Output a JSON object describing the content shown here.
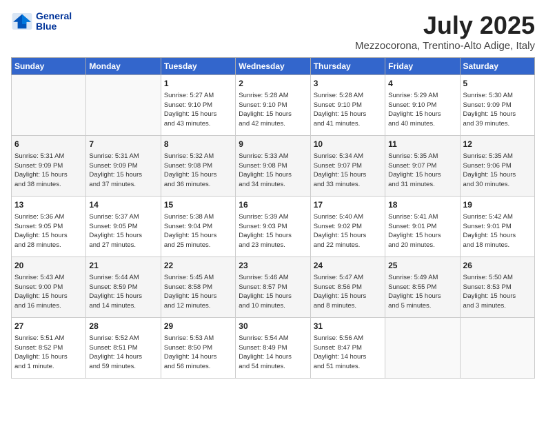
{
  "header": {
    "logo_line1": "General",
    "logo_line2": "Blue",
    "month_year": "July 2025",
    "location": "Mezzocorona, Trentino-Alto Adige, Italy"
  },
  "weekdays": [
    "Sunday",
    "Monday",
    "Tuesday",
    "Wednesday",
    "Thursday",
    "Friday",
    "Saturday"
  ],
  "weeks": [
    [
      {
        "day": "",
        "info": ""
      },
      {
        "day": "",
        "info": ""
      },
      {
        "day": "1",
        "info": "Sunrise: 5:27 AM\nSunset: 9:10 PM\nDaylight: 15 hours\nand 43 minutes."
      },
      {
        "day": "2",
        "info": "Sunrise: 5:28 AM\nSunset: 9:10 PM\nDaylight: 15 hours\nand 42 minutes."
      },
      {
        "day": "3",
        "info": "Sunrise: 5:28 AM\nSunset: 9:10 PM\nDaylight: 15 hours\nand 41 minutes."
      },
      {
        "day": "4",
        "info": "Sunrise: 5:29 AM\nSunset: 9:10 PM\nDaylight: 15 hours\nand 40 minutes."
      },
      {
        "day": "5",
        "info": "Sunrise: 5:30 AM\nSunset: 9:09 PM\nDaylight: 15 hours\nand 39 minutes."
      }
    ],
    [
      {
        "day": "6",
        "info": "Sunrise: 5:31 AM\nSunset: 9:09 PM\nDaylight: 15 hours\nand 38 minutes."
      },
      {
        "day": "7",
        "info": "Sunrise: 5:31 AM\nSunset: 9:09 PM\nDaylight: 15 hours\nand 37 minutes."
      },
      {
        "day": "8",
        "info": "Sunrise: 5:32 AM\nSunset: 9:08 PM\nDaylight: 15 hours\nand 36 minutes."
      },
      {
        "day": "9",
        "info": "Sunrise: 5:33 AM\nSunset: 9:08 PM\nDaylight: 15 hours\nand 34 minutes."
      },
      {
        "day": "10",
        "info": "Sunrise: 5:34 AM\nSunset: 9:07 PM\nDaylight: 15 hours\nand 33 minutes."
      },
      {
        "day": "11",
        "info": "Sunrise: 5:35 AM\nSunset: 9:07 PM\nDaylight: 15 hours\nand 31 minutes."
      },
      {
        "day": "12",
        "info": "Sunrise: 5:35 AM\nSunset: 9:06 PM\nDaylight: 15 hours\nand 30 minutes."
      }
    ],
    [
      {
        "day": "13",
        "info": "Sunrise: 5:36 AM\nSunset: 9:05 PM\nDaylight: 15 hours\nand 28 minutes."
      },
      {
        "day": "14",
        "info": "Sunrise: 5:37 AM\nSunset: 9:05 PM\nDaylight: 15 hours\nand 27 minutes."
      },
      {
        "day": "15",
        "info": "Sunrise: 5:38 AM\nSunset: 9:04 PM\nDaylight: 15 hours\nand 25 minutes."
      },
      {
        "day": "16",
        "info": "Sunrise: 5:39 AM\nSunset: 9:03 PM\nDaylight: 15 hours\nand 23 minutes."
      },
      {
        "day": "17",
        "info": "Sunrise: 5:40 AM\nSunset: 9:02 PM\nDaylight: 15 hours\nand 22 minutes."
      },
      {
        "day": "18",
        "info": "Sunrise: 5:41 AM\nSunset: 9:01 PM\nDaylight: 15 hours\nand 20 minutes."
      },
      {
        "day": "19",
        "info": "Sunrise: 5:42 AM\nSunset: 9:01 PM\nDaylight: 15 hours\nand 18 minutes."
      }
    ],
    [
      {
        "day": "20",
        "info": "Sunrise: 5:43 AM\nSunset: 9:00 PM\nDaylight: 15 hours\nand 16 minutes."
      },
      {
        "day": "21",
        "info": "Sunrise: 5:44 AM\nSunset: 8:59 PM\nDaylight: 15 hours\nand 14 minutes."
      },
      {
        "day": "22",
        "info": "Sunrise: 5:45 AM\nSunset: 8:58 PM\nDaylight: 15 hours\nand 12 minutes."
      },
      {
        "day": "23",
        "info": "Sunrise: 5:46 AM\nSunset: 8:57 PM\nDaylight: 15 hours\nand 10 minutes."
      },
      {
        "day": "24",
        "info": "Sunrise: 5:47 AM\nSunset: 8:56 PM\nDaylight: 15 hours\nand 8 minutes."
      },
      {
        "day": "25",
        "info": "Sunrise: 5:49 AM\nSunset: 8:55 PM\nDaylight: 15 hours\nand 5 minutes."
      },
      {
        "day": "26",
        "info": "Sunrise: 5:50 AM\nSunset: 8:53 PM\nDaylight: 15 hours\nand 3 minutes."
      }
    ],
    [
      {
        "day": "27",
        "info": "Sunrise: 5:51 AM\nSunset: 8:52 PM\nDaylight: 15 hours\nand 1 minute."
      },
      {
        "day": "28",
        "info": "Sunrise: 5:52 AM\nSunset: 8:51 PM\nDaylight: 14 hours\nand 59 minutes."
      },
      {
        "day": "29",
        "info": "Sunrise: 5:53 AM\nSunset: 8:50 PM\nDaylight: 14 hours\nand 56 minutes."
      },
      {
        "day": "30",
        "info": "Sunrise: 5:54 AM\nSunset: 8:49 PM\nDaylight: 14 hours\nand 54 minutes."
      },
      {
        "day": "31",
        "info": "Sunrise: 5:56 AM\nSunset: 8:47 PM\nDaylight: 14 hours\nand 51 minutes."
      },
      {
        "day": "",
        "info": ""
      },
      {
        "day": "",
        "info": ""
      }
    ]
  ]
}
